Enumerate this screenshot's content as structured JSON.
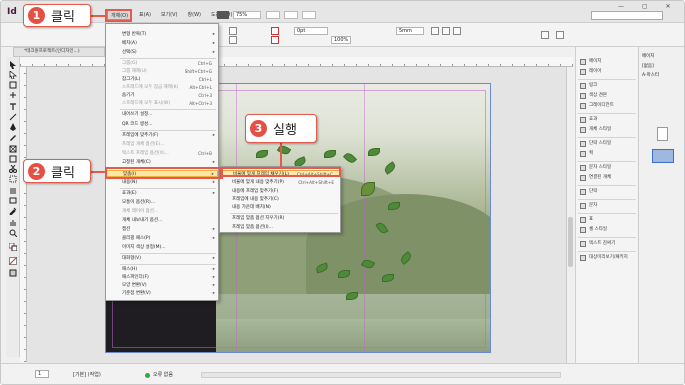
{
  "app": {
    "logo": "Id",
    "menus": [
      "개체(O)",
      "표(A)",
      "보기(V)",
      "창(W)",
      "도움말(H)"
    ],
    "zoom": "75%",
    "search_placeholder": "",
    "window_buttons": "— ▢ ✕"
  },
  "control_bar": {
    "stroke_weight": "0pt",
    "opacity": "100%",
    "width": "5mm"
  },
  "document_tab": "*테크원프로젝트(인디자인...)",
  "object_menu": {
    "items": [
      {
        "label": "변형 반복(T)",
        "shortcut": "",
        "submenu": true,
        "disabled": false
      },
      {
        "label": "배치(A)",
        "shortcut": "",
        "submenu": true,
        "disabled": false
      },
      {
        "label": "선택(S)",
        "shortcut": "",
        "submenu": true,
        "disabled": false
      },
      {
        "label": "그룹(G)",
        "shortcut": "Ctrl+G",
        "submenu": false,
        "disabled": true
      },
      {
        "label": "그룹 해제(U)",
        "shortcut": "Shift+Ctrl+G",
        "submenu": false,
        "disabled": true
      },
      {
        "label": "잠그기(L)",
        "shortcut": "Ctrl+L",
        "submenu": false,
        "disabled": false
      },
      {
        "label": "스프레드에 모두 잠금 해제(K)",
        "shortcut": "Alt+Ctrl+L",
        "submenu": false,
        "disabled": true
      },
      {
        "label": "숨기기",
        "shortcut": "Ctrl+3",
        "submenu": false,
        "disabled": false
      },
      {
        "label": "스프레드에 모두 표시(W)",
        "shortcut": "Alt+Ctrl+3",
        "submenu": false,
        "disabled": true
      },
      {
        "label": "내어쓰기 설정...",
        "shortcut": "",
        "submenu": false,
        "disabled": false
      },
      {
        "label": "QR 코드 생성...",
        "shortcut": "",
        "submenu": false,
        "disabled": false
      },
      {
        "label": "프레임에 맞추기(F)",
        "shortcut": "",
        "submenu": true,
        "disabled": false
      },
      {
        "label": "프레임 개체 옵션(E)...",
        "shortcut": "",
        "submenu": false,
        "disabled": true
      },
      {
        "label": "텍스트 프레임 옵션(X)...",
        "shortcut": "Ctrl+B",
        "submenu": false,
        "disabled": true
      },
      {
        "label": "고정된 개체(C)",
        "shortcut": "",
        "submenu": true,
        "disabled": false
      },
      {
        "label": "맞춤(I)",
        "shortcut": "",
        "submenu": true,
        "disabled": false
      },
      {
        "label": "내용(N)",
        "shortcut": "",
        "submenu": true,
        "disabled": false
      },
      {
        "label": "효과(E)",
        "shortcut": "",
        "submenu": true,
        "disabled": false
      },
      {
        "label": "모퉁이 옵션(R)...",
        "shortcut": "",
        "submenu": false,
        "disabled": false
      },
      {
        "label": "개체 레이어 옵션...",
        "shortcut": "",
        "submenu": false,
        "disabled": true
      },
      {
        "label": "개체 내보내기 옵션...",
        "shortcut": "",
        "submenu": false,
        "disabled": false
      },
      {
        "label": "캡션",
        "shortcut": "",
        "submenu": true,
        "disabled": false
      },
      {
        "label": "클리핑 패스(P)",
        "shortcut": "",
        "submenu": true,
        "disabled": false
      },
      {
        "label": "이미지 색상 설정(M)...",
        "shortcut": "",
        "submenu": false,
        "disabled": false
      },
      {
        "label": "대화형(V)",
        "shortcut": "",
        "submenu": true,
        "disabled": false
      },
      {
        "label": "패스(H)",
        "shortcut": "",
        "submenu": true,
        "disabled": false
      },
      {
        "label": "패스파인더(F)",
        "shortcut": "",
        "submenu": true,
        "disabled": false
      },
      {
        "label": "모양 변환(V)",
        "shortcut": "",
        "submenu": true,
        "disabled": false
      },
      {
        "label": "기준점 변환(V)",
        "shortcut": "",
        "submenu": true,
        "disabled": false
      },
      {
        "label": "표준 표시 강화(Y)",
        "shortcut": "",
        "submenu": false,
        "disabled": false
      }
    ],
    "highlight_index": 15
  },
  "fit_submenu": {
    "items": [
      {
        "label": "비율에 맞게 프레임 채우기(L)",
        "shortcut": "Ctrl+Alt+Shift+C"
      },
      {
        "label": "비율에 맞게 내용 맞추기(P)",
        "shortcut": "Ctrl+Alt+Shift+E"
      },
      {
        "label": "내용에 프레임 맞추기(F)",
        "shortcut": ""
      },
      {
        "label": "프레임에 내용 맞추기(C)",
        "shortcut": ""
      },
      {
        "label": "내용 가운데 배치(N)",
        "shortcut": ""
      },
      {
        "label": "프레임 맞춤 옵션 지우기(R)",
        "shortcut": ""
      },
      {
        "label": "프레임 맞춤 옵션(I)...",
        "shortcut": ""
      }
    ],
    "highlight_index": 0
  },
  "callouts": [
    {
      "number": "1",
      "text": "클릭"
    },
    {
      "number": "2",
      "text": "클릭"
    },
    {
      "number": "3",
      "text": "실행"
    }
  ],
  "panels": [
    {
      "label": "페이지"
    },
    {
      "label": "레이어"
    },
    {
      "label": "링크"
    },
    {
      "label": "색상 견본"
    },
    {
      "label": "그레이디언트"
    },
    {
      "label": "효과"
    },
    {
      "label": "개체 스타일"
    },
    {
      "label": "단락 스타일"
    },
    {
      "label": "획"
    },
    {
      "label": "문자 스타일"
    },
    {
      "label": "연결된 개체"
    },
    {
      "label": "단락"
    },
    {
      "label": "문자"
    },
    {
      "label": "표"
    },
    {
      "label": "셀 스타일"
    },
    {
      "label": "텍스트 감싸기"
    },
    {
      "label": "대상미리보기/패키지"
    }
  ],
  "pages_panel": {
    "header": "페이지",
    "none_label": "[없음]",
    "master_label": "A-마스터"
  },
  "status": {
    "page": "1",
    "master": "[기본] (작업)",
    "errors": "오류 없음"
  },
  "colors": {
    "callout_red": "#e65044",
    "menu_highlight": "#ffe5a6"
  }
}
